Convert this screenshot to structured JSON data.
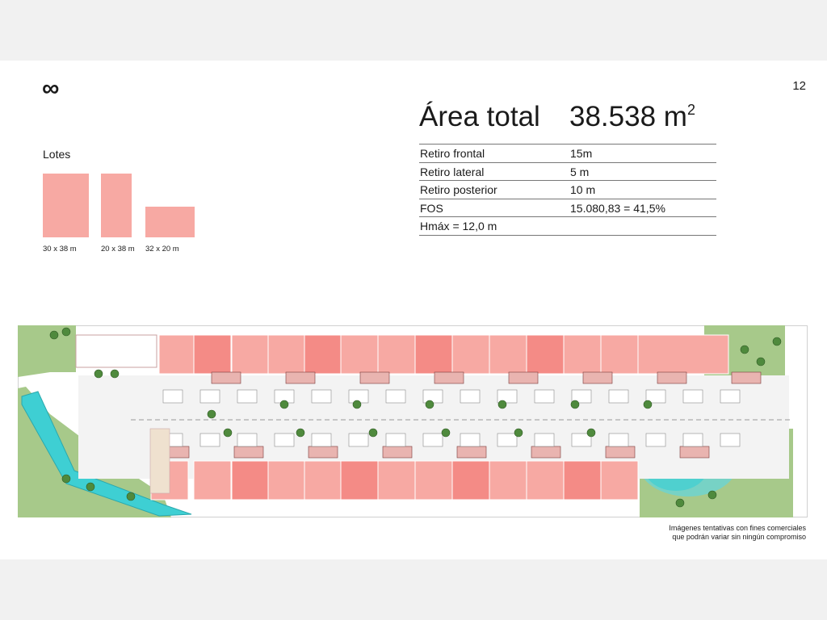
{
  "header": {
    "logo": "∞",
    "page_number": "12"
  },
  "area": {
    "label": "Área total",
    "value": "38.538 m",
    "unit_superscript": "2"
  },
  "specs": [
    {
      "key": "Retiro frontal",
      "value": "15m"
    },
    {
      "key": "Retiro lateral",
      "value": "5 m"
    },
    {
      "key": "Retiro posterior",
      "value": "10 m"
    },
    {
      "key": "FOS",
      "value": "15.080,83 = 41,5%"
    },
    {
      "key": "Hmáx = 12,0 m",
      "value": ""
    }
  ],
  "lotes": {
    "title": "Lotes",
    "items": [
      {
        "label": "30 x 38 m"
      },
      {
        "label": "20 x 38 m"
      },
      {
        "label": "32 x 20 m"
      }
    ]
  },
  "colors": {
    "lot_light": "#f7a9a3",
    "lot_dark": "#f48b86",
    "green": "#a7c98a",
    "water": "#3ecfd3",
    "road": "#e8e8e8"
  },
  "disclaimer": {
    "line1": "Imágenes tentativas con fines comerciales",
    "line2": "que podrán variar sin ningún compromiso"
  }
}
